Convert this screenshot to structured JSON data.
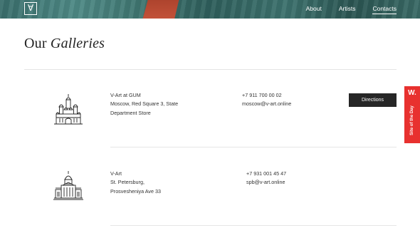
{
  "header": {
    "logo_glyph": "∀",
    "nav": [
      "About",
      "Artists",
      "Contacts"
    ],
    "active_nav": "Contacts"
  },
  "page": {
    "title_plain": "Our",
    "title_italic": "Galleries"
  },
  "galleries": [
    {
      "name": "V-Art at GUM",
      "address_lines": [
        "Moscow, Red Square 3, State",
        "Department Store"
      ],
      "phone": "+7 911 700 00 02",
      "email": "moscow@v-art.online",
      "button_label": "Directions",
      "icon": "st-basils-cathedral-icon"
    },
    {
      "name": "V-Art",
      "address_lines": [
        "St. Petersburg,",
        "Prosvesheniya Ave 33"
      ],
      "phone": "+7 931 001 45 47",
      "email": "spb@v-art.online",
      "icon": "palace-building-icon"
    }
  ],
  "badge": {
    "mark": "W.",
    "label": "Site of the Day"
  },
  "colors": {
    "badge": "#e8312f",
    "button": "#262626",
    "header": "#3a6e6c"
  }
}
